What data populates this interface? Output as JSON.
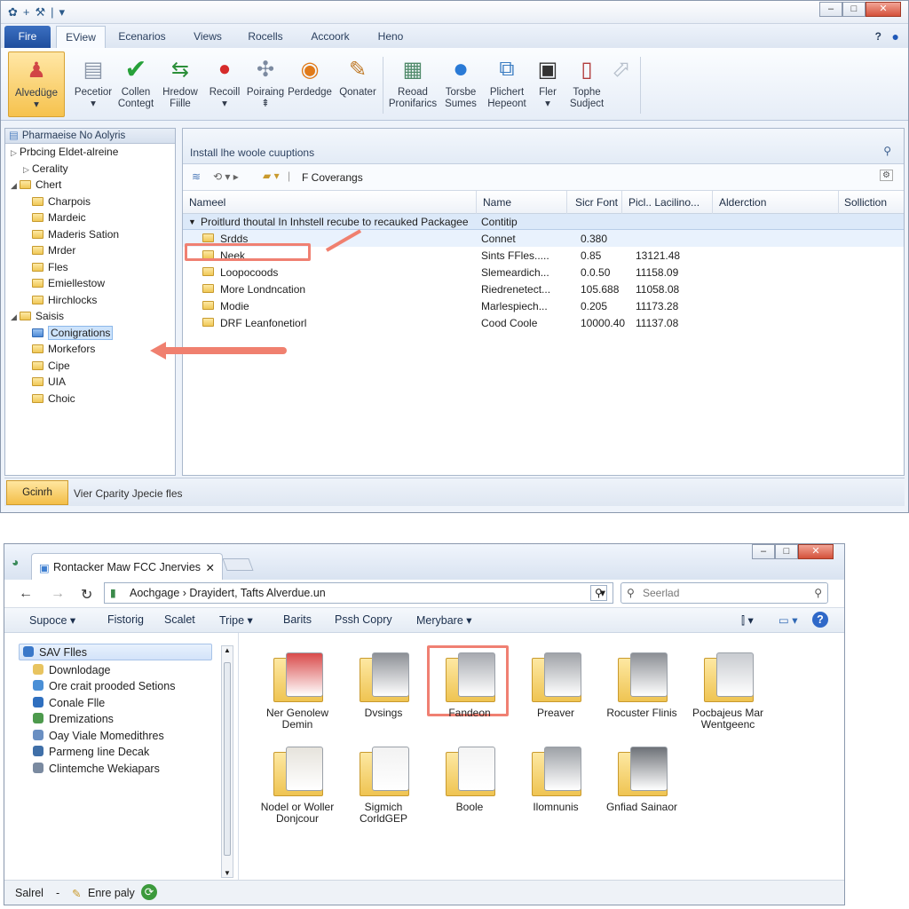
{
  "top_window": {
    "tabs": [
      "Fire",
      "EView",
      "Ecenarios",
      "Views",
      "Rocells",
      "Accoork",
      "Heno"
    ],
    "ribbon": [
      {
        "label": "Alvedüge",
        "icon": "person-icon"
      },
      {
        "label": "Pecetior",
        "icon": "document-icon"
      },
      {
        "label": "Collen Contegt",
        "icon": "checkmark-icon"
      },
      {
        "label": "Hredow Fiille",
        "icon": "green-arrow-icon"
      },
      {
        "label": "Recoill",
        "icon": "red-ball-icon"
      },
      {
        "label": "Poiraing",
        "icon": "crosshair-icon"
      },
      {
        "label": "Perdedge",
        "icon": "globe-icon"
      },
      {
        "label": "Qonater",
        "icon": "tools-icon"
      },
      {
        "label": "Reoad Pronifarics",
        "icon": "monitor-icon"
      },
      {
        "label": "Torsbe Sumes",
        "icon": "blue-globe-icon"
      },
      {
        "label": "Plichert Hepeont",
        "icon": "network-icon"
      },
      {
        "label": "Fler",
        "icon": "terminal-icon"
      },
      {
        "label": "Tophe Sudject",
        "icon": "page-icon"
      }
    ],
    "left_pane": {
      "header": "Pharmaeise No Aolyris",
      "items": [
        {
          "label": "Prbcing Eldet-alreine",
          "level": 0,
          "arrow": "▷",
          "folder": false
        },
        {
          "label": "Cerality",
          "level": 1,
          "arrow": "▷",
          "folder": false
        },
        {
          "label": "Chert",
          "level": 0,
          "arrow": "◢",
          "folder": true
        },
        {
          "label": "Charpois",
          "level": 1,
          "arrow": "",
          "folder": true
        },
        {
          "label": "Mardeic",
          "level": 1,
          "arrow": "",
          "folder": true
        },
        {
          "label": "Maderis Sation",
          "level": 1,
          "arrow": "",
          "folder": true
        },
        {
          "label": "Mrder",
          "level": 1,
          "arrow": "",
          "folder": true
        },
        {
          "label": "Fles",
          "level": 1,
          "arrow": "",
          "folder": true
        },
        {
          "label": "Emiellestow",
          "level": 1,
          "arrow": "",
          "folder": true
        },
        {
          "label": "Hirchlocks",
          "level": 1,
          "arrow": "",
          "folder": true
        },
        {
          "label": "Saisis",
          "level": 0,
          "arrow": "◢",
          "folder": true
        },
        {
          "label": "Conigrations",
          "level": 1,
          "arrow": "",
          "folder": true,
          "selected": true
        },
        {
          "label": "Morkefors",
          "level": 1,
          "arrow": "",
          "folder": true
        },
        {
          "label": "Cipe",
          "level": 1,
          "arrow": "",
          "folder": true
        },
        {
          "label": "UIA",
          "level": 1,
          "arrow": "",
          "folder": true
        },
        {
          "label": "Choic",
          "level": 1,
          "arrow": "",
          "folder": true
        }
      ]
    },
    "right_pane": {
      "title": "Install lhe woole cuuptions",
      "breadcrumb": "F Coverangs",
      "columns": [
        "Nameel",
        "Name",
        "Sicr Font",
        "Picl.. Lacilino...",
        "Alderction",
        "Solliction"
      ],
      "group_row": {
        "name": "Proitlurd thoutal In Inhstell recube to recauked Packagee",
        "value": "Contitip"
      },
      "rows": [
        {
          "name": "Srdds",
          "type": "Connet",
          "size": "0.380",
          "date": ""
        },
        {
          "name": "Neek",
          "type": "Sints FFles.....",
          "size": "0.85",
          "date": "13121.48"
        },
        {
          "name": "Loopocoods",
          "type": "Slemeardich...",
          "size": "0.0.50",
          "date": "11158.09"
        },
        {
          "name": "More Londncation",
          "type": "Riedrenetect...",
          "size": "105.688",
          "date": "11058.08"
        },
        {
          "name": "Modie",
          "type": "Marlespiech...",
          "size": "0.205",
          "date": "11173.28"
        },
        {
          "name": "DRF Leanfonetiorl",
          "type": "Cood Coole",
          "size": "10000.40",
          "date": "11137.08"
        }
      ]
    },
    "status": {
      "button": "Gcinrh",
      "text": "Vier Cparity Jpecie fles"
    }
  },
  "bottom_window": {
    "tab_title": "Rontacker Maw FCC Jnervies",
    "address": "Aochgage  ›  Drayidert,  Tafts  Alverdue.un",
    "search_placeholder": "Seerlad",
    "commands": [
      "Supoce ▾",
      "Fistorig",
      "Scalet",
      "Tripe ▾",
      "Barits",
      "Pssh Copry",
      "Merybare ▾"
    ],
    "nav": [
      {
        "label": "SAV Flles",
        "icon_color": "#3a78c9"
      },
      {
        "label": "Downlodage",
        "icon_color": "#e8c460"
      },
      {
        "label": "Ore crait prooded Setions",
        "icon_color": "#4a8fd6"
      },
      {
        "label": "Conale Flle",
        "icon_color": "#2f6fbf"
      },
      {
        "label": "Dremizations",
        "icon_color": "#4d9a4d"
      },
      {
        "label": "Oay Viale Momedithres",
        "icon_color": "#6a8fc2"
      },
      {
        "label": "Parmeng Iine Decak",
        "icon_color": "#3f6fa8"
      },
      {
        "label": "Clintemche Wekiapars",
        "icon_color": "#7a8aa0"
      }
    ],
    "tiles": [
      {
        "label": "Ner Genolew Demin",
        "overlay": "#d94b4b"
      },
      {
        "label": "Dvsings",
        "overlay": "#8d9096"
      },
      {
        "label": "Fandeon",
        "overlay": "#a7aab0"
      },
      {
        "label": "Preaver",
        "overlay": "#a0a3a8"
      },
      {
        "label": "Rocuster Flinis",
        "overlay": "#8c8f95"
      },
      {
        "label": "Pocbajeus Mar Wentgeenc",
        "overlay": "#c8cbd0"
      },
      {
        "label": "Nodel or Woller Donjcour",
        "overlay": "#e6e3dc"
      },
      {
        "label": "Sigmich CorldGEP",
        "overlay": "#f2f2f2"
      },
      {
        "label": "Boole",
        "overlay": "#f4f4f4"
      },
      {
        "label": "Ilomnunis",
        "overlay": "#9ea2a7"
      },
      {
        "label": "Gnfiad Sainaor",
        "overlay": "#6e7278"
      }
    ],
    "status_left": "Salrel",
    "status_mid": "Enre paly"
  }
}
